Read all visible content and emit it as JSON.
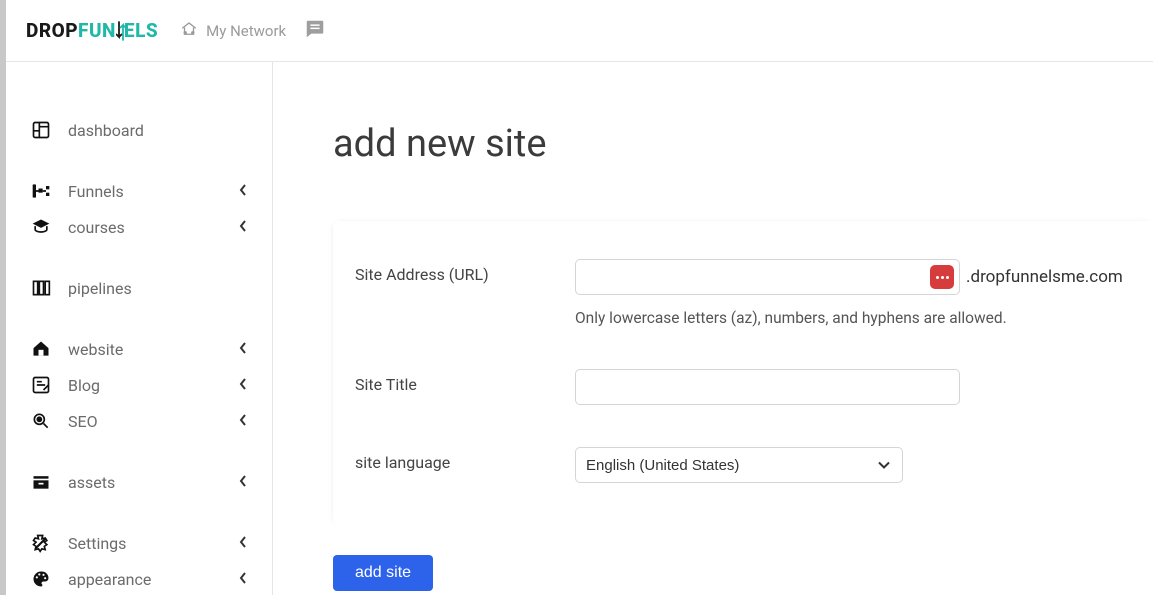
{
  "logo": {
    "part1": "DROP",
    "part2": "FUN",
    "part3": "ELS"
  },
  "header": {
    "network_label": "My Network"
  },
  "sidebar": {
    "groups": [
      {
        "items": [
          {
            "label": "dashboard",
            "expandable": false
          }
        ]
      },
      {
        "items": [
          {
            "label": "Funnels",
            "expandable": true
          },
          {
            "label": "courses",
            "expandable": true
          }
        ]
      },
      {
        "items": [
          {
            "label": "pipelines",
            "expandable": false
          }
        ]
      },
      {
        "items": [
          {
            "label": "website",
            "expandable": true
          },
          {
            "label": "Blog",
            "expandable": true
          },
          {
            "label": "SEO",
            "expandable": true
          }
        ]
      },
      {
        "items": [
          {
            "label": "assets",
            "expandable": true
          }
        ]
      },
      {
        "items": [
          {
            "label": "Settings",
            "expandable": true
          },
          {
            "label": "appearance",
            "expandable": true
          }
        ]
      }
    ]
  },
  "page": {
    "title": "add new site",
    "form": {
      "site_address": {
        "label": "Site Address (URL)",
        "value": "",
        "suffix": ".dropfunnelsme.com",
        "hint": "Only lowercase letters (az), numbers, and hyphens are allowed."
      },
      "site_title": {
        "label": "Site Title",
        "value": ""
      },
      "site_language": {
        "label": "site language",
        "selected": "English (United States)"
      }
    },
    "submit_label": "add site"
  }
}
